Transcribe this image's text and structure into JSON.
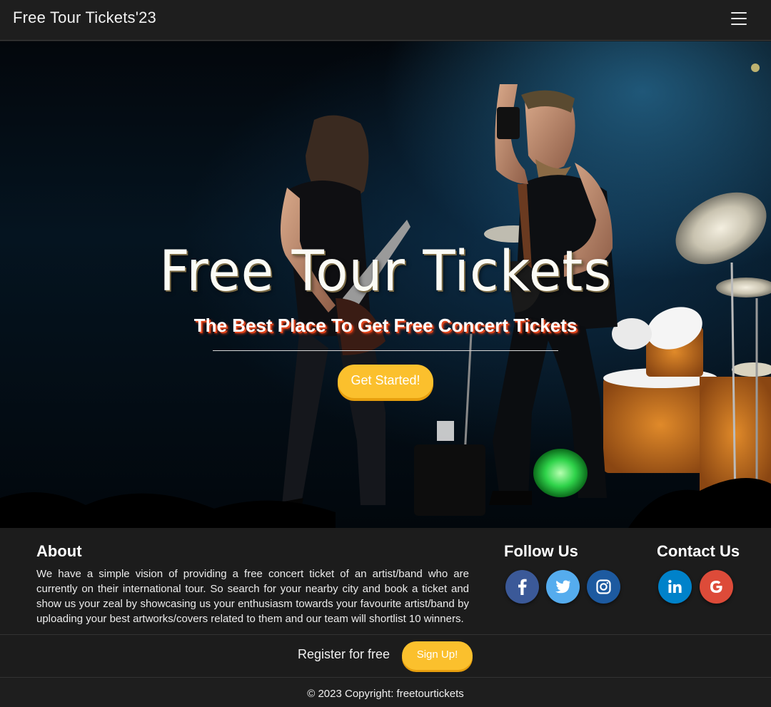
{
  "navbar": {
    "brand": "Free Tour Tickets'23",
    "menu_icon": "hamburger-menu-icon"
  },
  "hero": {
    "title": "Free Tour Tickets",
    "subtitle": "The Best Place To Get Free Concert Tickets",
    "cta_label": "Get Started!"
  },
  "about": {
    "heading": "About",
    "text": "We have a simple vision of providing a free concert ticket of an artist/band who are currently on their international tour. So search for your nearby city and book a ticket and show us your zeal by showcasing us your enthusiasm towards your favourite artist/band by uploading your best artworks/covers related to them and our team will shortlist 10 winners."
  },
  "follow": {
    "heading": "Follow Us",
    "icons": [
      "facebook-icon",
      "twitter-icon",
      "instagram-icon"
    ]
  },
  "contact": {
    "heading": "Contact Us",
    "icons": [
      "linkedin-icon",
      "google-icon"
    ]
  },
  "register": {
    "text": "Register for free",
    "button_label": "Sign Up!"
  },
  "footer": {
    "copyright": "© 2023 Copyright: freetourtickets"
  },
  "colors": {
    "accent": "#fbc02d",
    "facebook": "#3b5998",
    "twitter": "#55acee",
    "instagram": "#ac2bac",
    "linkedin": "#0082ca",
    "google": "#dd4b39",
    "background": "#1c1c1c"
  }
}
